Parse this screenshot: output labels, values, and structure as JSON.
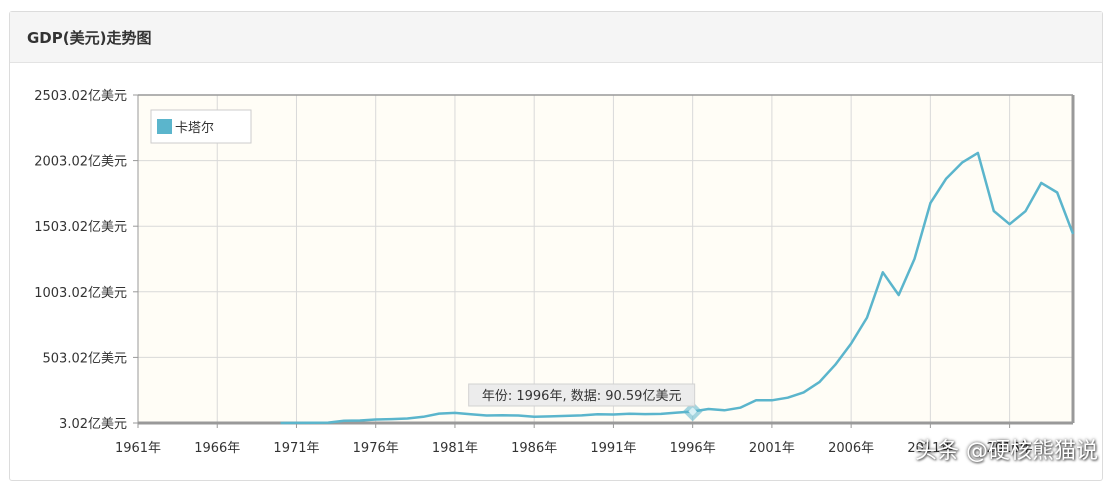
{
  "panel": {
    "title": "GDP(美元)走势图"
  },
  "watermark": "头条 @硬核熊猫说",
  "colors": {
    "line": "#5bb5cc",
    "plot_bg": "#fffdf6",
    "grid": "#d9d9d9",
    "axis": "#999999"
  },
  "chart_data": {
    "type": "line",
    "title": "",
    "xlabel": "",
    "ylabel": "",
    "x_ticks": [
      "1961年",
      "1966年",
      "1971年",
      "1976年",
      "1981年",
      "1986年",
      "1991年",
      "1996年",
      "2001年",
      "2006年",
      "2011年",
      "2016年"
    ],
    "y_ticks": [
      "3.02亿美元",
      "503.02亿美元",
      "1003.02亿美元",
      "1503.02亿美元",
      "2003.02亿美元",
      "2503.02亿美元"
    ],
    "ylim": [
      3.02,
      2503.02
    ],
    "xlim": [
      1961,
      2020
    ],
    "grid": true,
    "legend": {
      "placement": "top-left",
      "entries": [
        "卡塔尔"
      ]
    },
    "series": [
      {
        "name": "卡塔尔",
        "x": [
          1970,
          1971,
          1972,
          1973,
          1974,
          1975,
          1976,
          1977,
          1978,
          1979,
          1980,
          1981,
          1982,
          1983,
          1984,
          1985,
          1986,
          1987,
          1988,
          1989,
          1990,
          1991,
          1992,
          1993,
          1994,
          1995,
          1996,
          1997,
          1998,
          1999,
          2000,
          2001,
          2002,
          2003,
          2004,
          2005,
          2006,
          2007,
          2008,
          2009,
          2010,
          2011,
          2012,
          2013,
          2014,
          2015,
          2016,
          2017,
          2018,
          2019,
          2020
        ],
        "values": [
          3.02,
          3.9,
          4.5,
          6,
          20,
          22,
          30,
          33,
          37,
          50,
          75,
          80,
          70,
          60,
          62,
          60,
          50,
          53,
          57,
          61,
          70,
          68,
          73,
          71,
          72,
          82,
          90.59,
          110,
          100,
          120,
          177,
          176,
          196,
          236,
          315,
          447,
          608,
          806,
          1152,
          979,
          1254,
          1679,
          1866,
          1988,
          2062,
          1619,
          1518,
          1617,
          1833,
          1760,
          1444
        ]
      }
    ],
    "tooltip": {
      "text": "年份: 1996年, 数据: 90.59亿美元",
      "x": 1996,
      "value": 90.59
    }
  }
}
